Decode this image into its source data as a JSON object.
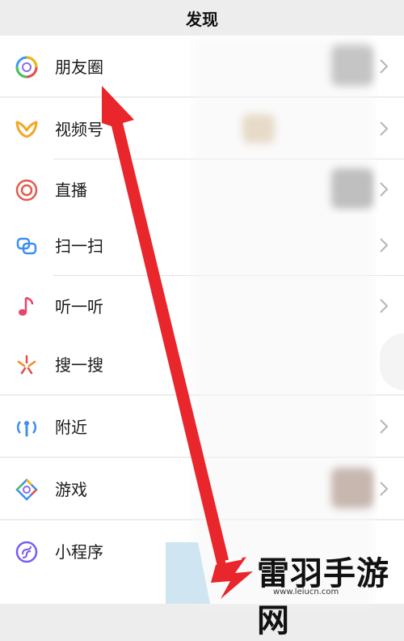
{
  "header": {
    "title": "发现"
  },
  "menu": {
    "moments": "朋友圈",
    "channels": "视频号",
    "live": "直播",
    "scan": "扫一扫",
    "listen": "听一听",
    "search": "搜一搜",
    "nearby": "附近",
    "games": "游戏",
    "miniprograms": "小程序"
  },
  "watermark": {
    "brand": "雷羽手游网",
    "url": "www.leiucn.com"
  },
  "colors": {
    "arrow": "#e8262b",
    "background": "#ededed",
    "row": "#ffffff"
  },
  "icons": [
    "moments-icon",
    "channels-icon",
    "live-icon",
    "scan-icon",
    "listen-icon",
    "search-icon",
    "nearby-icon",
    "games-icon",
    "miniprogram-icon",
    "chevron-right-icon"
  ]
}
